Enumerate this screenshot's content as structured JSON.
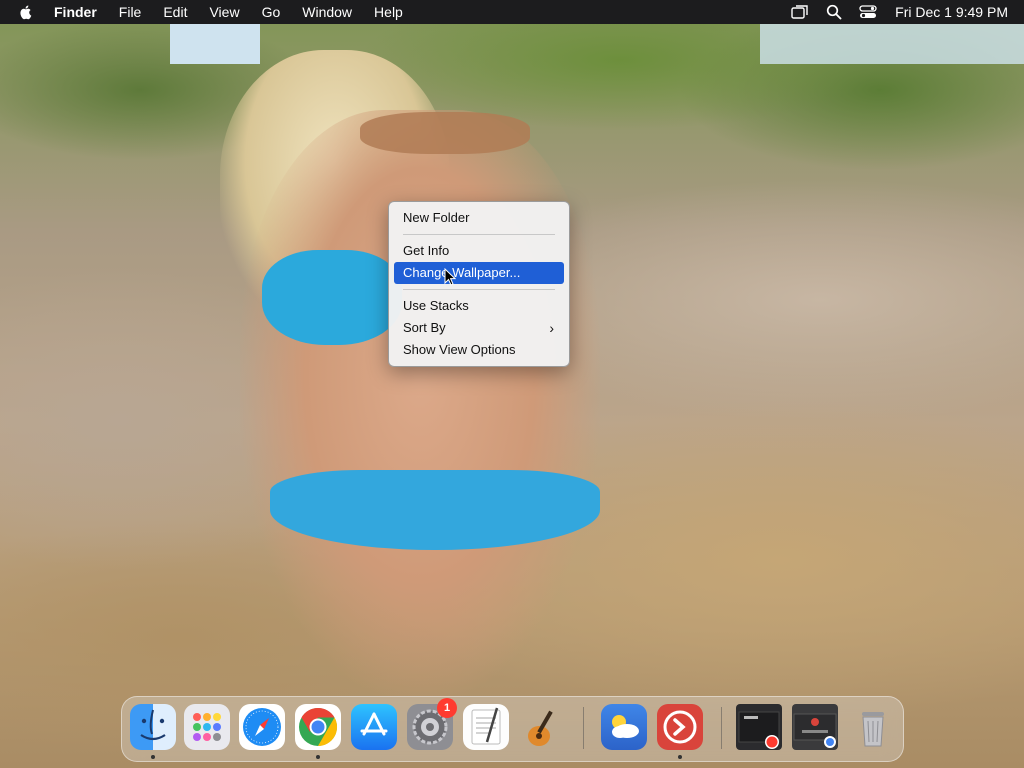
{
  "menubar": {
    "app_name": "Finder",
    "items": [
      "File",
      "Edit",
      "View",
      "Go",
      "Window",
      "Help"
    ],
    "status_icons": [
      "screen-mirroring-icon",
      "search-icon",
      "control-center-icon"
    ],
    "clock": "Fri Dec 1  9:49 PM"
  },
  "context_menu": {
    "groups": [
      [
        "New Folder"
      ],
      [
        "Get Info",
        "Change Wallpaper..."
      ],
      [
        "Use Stacks",
        "Sort By",
        "Show View Options"
      ]
    ],
    "highlighted": "Change Wallpaper...",
    "submenu_items": [
      "Sort By"
    ]
  },
  "dock": {
    "apps": [
      {
        "name": "Finder",
        "icon": "finder-icon",
        "running": true
      },
      {
        "name": "Launchpad",
        "icon": "launchpad-icon",
        "running": false
      },
      {
        "name": "Safari",
        "icon": "safari-icon",
        "running": false
      },
      {
        "name": "Google Chrome",
        "icon": "chrome-icon",
        "running": true
      },
      {
        "name": "App Store",
        "icon": "app-store-icon",
        "running": false
      },
      {
        "name": "System Settings",
        "icon": "system-settings-icon",
        "running": false,
        "badge": "1"
      },
      {
        "name": "TextEdit",
        "icon": "textedit-icon",
        "running": false
      },
      {
        "name": "GarageBand",
        "icon": "garageband-icon",
        "running": false
      },
      {
        "name": "Weather",
        "icon": "weather-icon",
        "running": false
      },
      {
        "name": "Remote Desktop",
        "icon": "remote-desktop-icon",
        "running": true
      },
      {
        "name": "Safari window",
        "icon": "minimized-safari-window-icon",
        "running": false
      },
      {
        "name": "Chrome window",
        "icon": "minimized-chrome-window-icon",
        "running": false
      },
      {
        "name": "Trash",
        "icon": "trash-icon",
        "running": false
      }
    ]
  },
  "colors": {
    "menubar_bg": "#1c1c1e",
    "menu_highlight": "#1f5fd6",
    "badge": "#ff3b30"
  }
}
